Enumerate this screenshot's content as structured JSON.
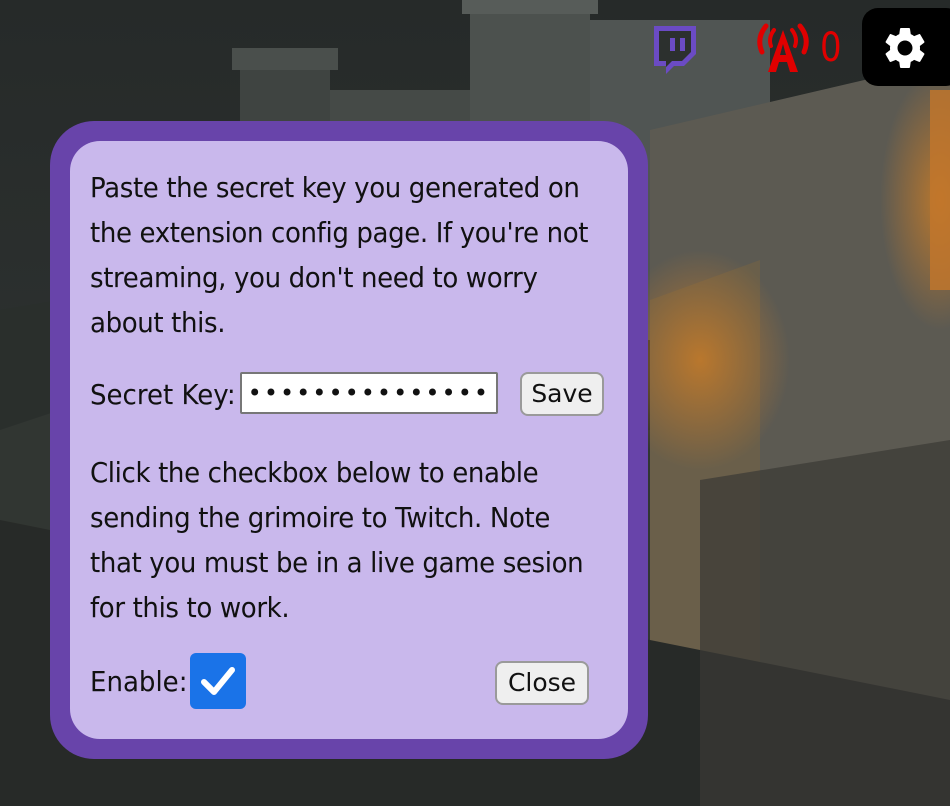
{
  "toolbar": {
    "twitch_icon": "twitch-icon",
    "live_icon": "broadcast-antenna-icon",
    "live_count": "0",
    "settings_icon": "gear-icon"
  },
  "dialog": {
    "intro_text": "Paste the secret key you generated on the extension config page. If you're not streaming, you don't need to worry about this.",
    "secret_key_label": "Secret Key:",
    "secret_key_value": "••••••••••••••••••••••••••",
    "save_label": "Save",
    "twitch_text": "Click the checkbox below to enable sending the grimoire to Twitch. Note that you must be in a live game sesion for this to work.",
    "enable_label": "Enable:",
    "enable_checked": true,
    "close_label": "Close"
  },
  "colors": {
    "dialog_border": "#6844aa",
    "dialog_background": "#c9b8ec",
    "twitch_purple": "#6b4bc4",
    "live_red": "#e00000",
    "checkbox_blue": "#1a73e8"
  }
}
